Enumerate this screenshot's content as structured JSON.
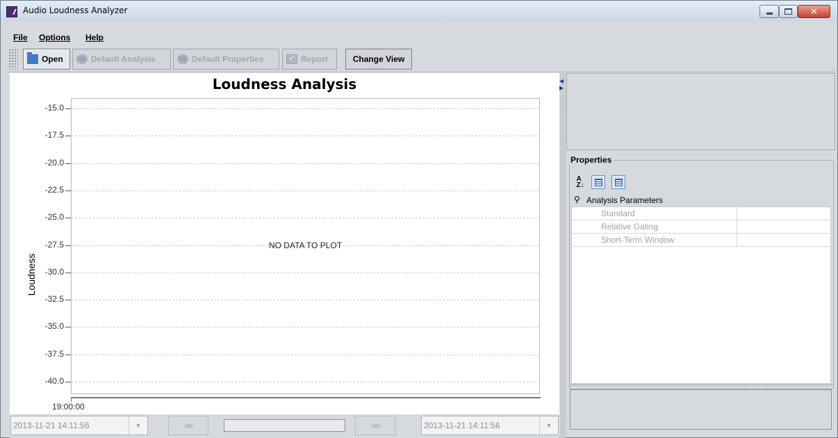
{
  "window": {
    "title": "Audio Loudness Analyzer"
  },
  "menu": {
    "items": [
      "File",
      "Options",
      "Help"
    ]
  },
  "toolbar": {
    "open": "Open",
    "default_analysis": "Default Analysis",
    "default_properties": "Default Properties",
    "report": "Report",
    "change_view": "Change View"
  },
  "chart_data": {
    "type": "line",
    "title": "Loudness Analysis",
    "ylabel": "Loudness",
    "xlabel": "",
    "yticks": [
      "-15.0",
      "-17.5",
      "-20.0",
      "-22.5",
      "-25.0",
      "-27.5",
      "-30.0",
      "-32.5",
      "-35.0",
      "-37.5",
      "-40.0"
    ],
    "ylim": [
      -40.0,
      -15.0
    ],
    "xticks": [
      "19:00:00"
    ],
    "grid": true,
    "series": [],
    "message": "NO DATA TO PLOT"
  },
  "bottom": {
    "start_time": "2013-11-21 14:11:56",
    "end_time": "2013-11-21 14:11:56",
    "prev_symbol": "<<",
    "next_symbol": ">>"
  },
  "properties": {
    "title": "Properties",
    "category": "Analysis Parameters",
    "rows": [
      "Standard",
      "Relative Gating",
      "Short-Term Window"
    ]
  }
}
